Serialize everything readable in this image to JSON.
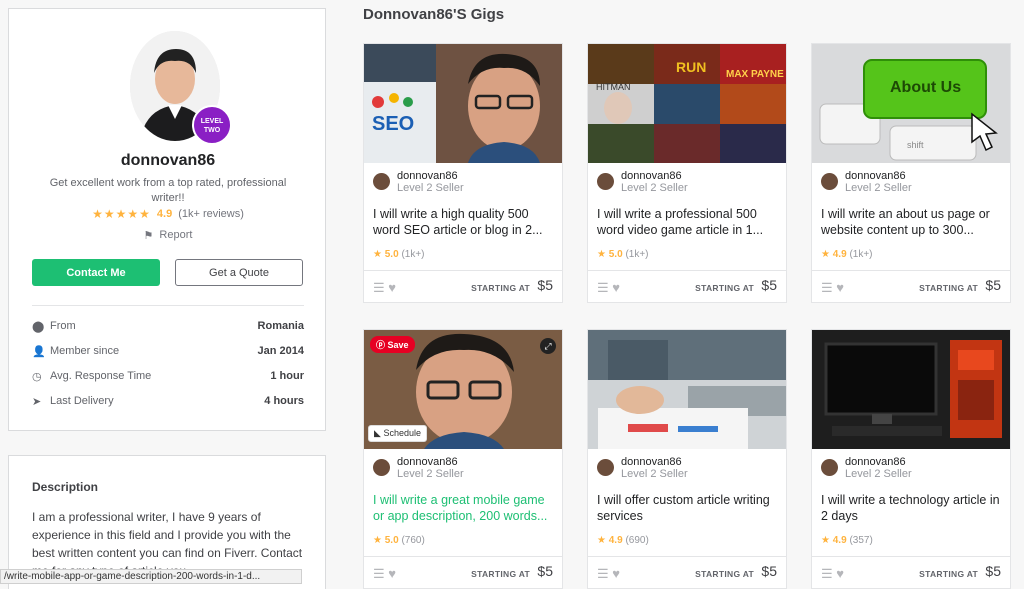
{
  "profile": {
    "username": "donnovan86",
    "level_badge_line1": "LEVEL",
    "level_badge_line2": "TWO",
    "tagline": "Get excellent work from a top rated, professional writer!!",
    "rating": "4.9",
    "reviews": "(1k+ reviews)",
    "report": "Report",
    "contact_label": "Contact Me",
    "quote_label": "Get a Quote",
    "stats": [
      {
        "label": "From",
        "value": "Romania"
      },
      {
        "label": "Member since",
        "value": "Jan 2014"
      },
      {
        "label": "Avg. Response Time",
        "value": "1 hour"
      },
      {
        "label": "Last Delivery",
        "value": "4 hours"
      }
    ]
  },
  "description": {
    "title": "Description",
    "text": "I am a professional writer, I have 9 years of experience in this field and I provide you with the best written content you can find on Fiverr. Contact me for any type of article you"
  },
  "status_url": "/write-mobile-app-or-game-description-200-words-in-1-d...",
  "gigs_title": "Donnovan86'S Gigs",
  "thumb_text": {
    "seo": "SEO",
    "about_us": "About Us",
    "shift": "shift",
    "run": "RUN",
    "max_payne": "MAX PAYNE",
    "hitman": "HITMAN"
  },
  "gigs": [
    {
      "seller": "donnovan86",
      "level": "Level 2 Seller",
      "title": "I will write a high quality 500 word SEO article or blog in 2...",
      "rating": "5.0",
      "count": "(1k+)",
      "starting": "STARTING AT",
      "price": "$5"
    },
    {
      "seller": "donnovan86",
      "level": "Level 2 Seller",
      "title": "I will write a professional 500 word video game article in 1...",
      "rating": "5.0",
      "count": "(1k+)",
      "starting": "STARTING AT",
      "price": "$5"
    },
    {
      "seller": "donnovan86",
      "level": "Level 2 Seller",
      "title": "I will write an about us page or website content up to 300...",
      "rating": "4.9",
      "count": "(1k+)",
      "starting": "STARTING AT",
      "price": "$5"
    },
    {
      "seller": "donnovan86",
      "level": "Level 2 Seller",
      "title": "I will write a great mobile game or app description, 200 words...",
      "rating": "5.0",
      "count": "(760)",
      "starting": "STARTING AT",
      "price": "$5"
    },
    {
      "seller": "donnovan86",
      "level": "Level 2 Seller",
      "title": "I will offer custom article writing services",
      "rating": "4.9",
      "count": "(690)",
      "starting": "STARTING AT",
      "price": "$5"
    },
    {
      "seller": "donnovan86",
      "level": "Level 2 Seller",
      "title": "I will write a technology article in 2 days",
      "rating": "4.9",
      "count": "(357)",
      "starting": "STARTING AT",
      "price": "$5"
    }
  ],
  "overlay": {
    "save": "Save",
    "schedule": "Schedule"
  },
  "colors": {
    "accent": "#1dbf73",
    "star": "#ffb33e",
    "badge": "#8a1fc4"
  }
}
